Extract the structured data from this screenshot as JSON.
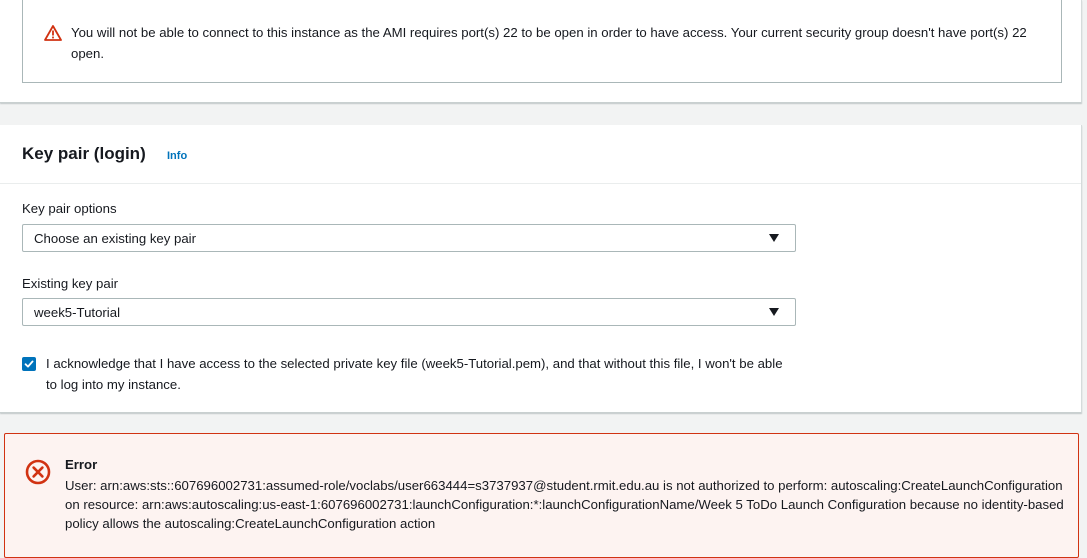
{
  "warning": {
    "message": "You will not be able to connect to this instance as the AMI requires port(s) 22 to be open in order to have access. Your current security group doesn't have port(s) 22 open.",
    "icon": "warning-triangle-icon",
    "color": "#d13212"
  },
  "key_pair": {
    "title": "Key pair (login)",
    "info_label": "Info",
    "options_label": "Key pair options",
    "options_value": "Choose an existing key pair",
    "existing_label": "Existing key pair",
    "existing_value": "week5-Tutorial",
    "acknowledge_checked": true,
    "acknowledge_text": "I acknowledge that I have access to the selected private key file (week5-Tutorial.pem), and that without this file, I won't be able to log into my instance."
  },
  "error": {
    "title": "Error",
    "message": "User: arn:aws:sts::607696002731:assumed-role/voclabs/user663444=s3737937@student.rmit.edu.au is not authorized to perform: autoscaling:CreateLaunchConfiguration on resource: arn:aws:autoscaling:us-east-1:607696002731:launchConfiguration:*:launchConfigurationName/Week 5 ToDo Launch Configuration because no identity-based policy allows the autoscaling:CreateLaunchConfiguration action",
    "icon": "error-circle-x-icon",
    "color": "#d13212",
    "background": "#fdf3f1"
  },
  "colors": {
    "link": "#0073bb",
    "checkbox": "#0073bb",
    "page_background": "#f2f3f3"
  }
}
